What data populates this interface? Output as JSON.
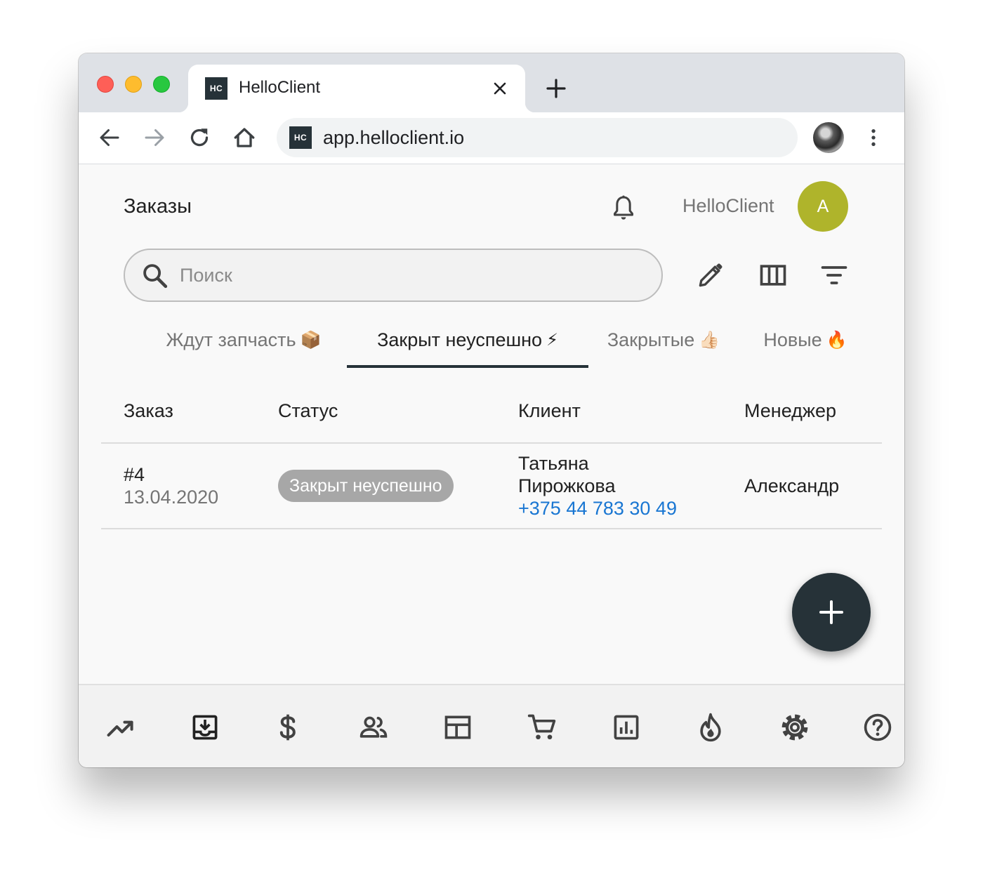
{
  "browser": {
    "tab_title": "HelloClient",
    "favicon_text": "HC",
    "url": "app.helloclient.io",
    "icons": [
      "close-icon",
      "plus-icon",
      "back-arrow-icon",
      "forward-arrow-icon",
      "reload-icon",
      "home-icon",
      "more-vert-icon"
    ]
  },
  "header": {
    "title": "Заказы",
    "account_name": "HelloClient",
    "avatar_letter": "A",
    "avatar_color": "#afb42b"
  },
  "search": {
    "placeholder": "Поиск",
    "value": ""
  },
  "tools": [
    "edit-pencil-icon",
    "columns-icon",
    "filter-icon"
  ],
  "status_tabs": [
    {
      "label": "Ждут запчасть",
      "emoji": "📦",
      "active": false
    },
    {
      "label": "Закрыт неуспешно",
      "emoji": "⚡",
      "active": true
    },
    {
      "label": "Закрытые",
      "emoji": "👍🏻",
      "active": false
    },
    {
      "label": "Новые",
      "emoji": "🔥",
      "active": false
    }
  ],
  "table": {
    "columns": [
      "Заказ",
      "Статус",
      "Клиент",
      "Менеджер"
    ],
    "rows": [
      {
        "order_number": "#4",
        "order_date": "13.04.2020",
        "status": "Закрыт неуспешно",
        "client_first_name": "Татьяна",
        "client_last_name": "Пирожкова",
        "client_phone": "+375 44 783 30 49",
        "manager": "Александр"
      }
    ]
  },
  "fab": {
    "icon": "plus-icon"
  },
  "bottom_nav": [
    "trending-up-icon",
    "inbox-download-icon",
    "dollar-icon",
    "people-icon",
    "table-layout-icon",
    "shopping-cart-icon",
    "bar-chart-icon",
    "fire-icon",
    "settings-gear-icon",
    "help-circle-icon"
  ],
  "colors": {
    "primary_dark": "#263238",
    "link": "#1976d2",
    "chip": "#a7a7a7",
    "background": "#f9f9f9"
  }
}
